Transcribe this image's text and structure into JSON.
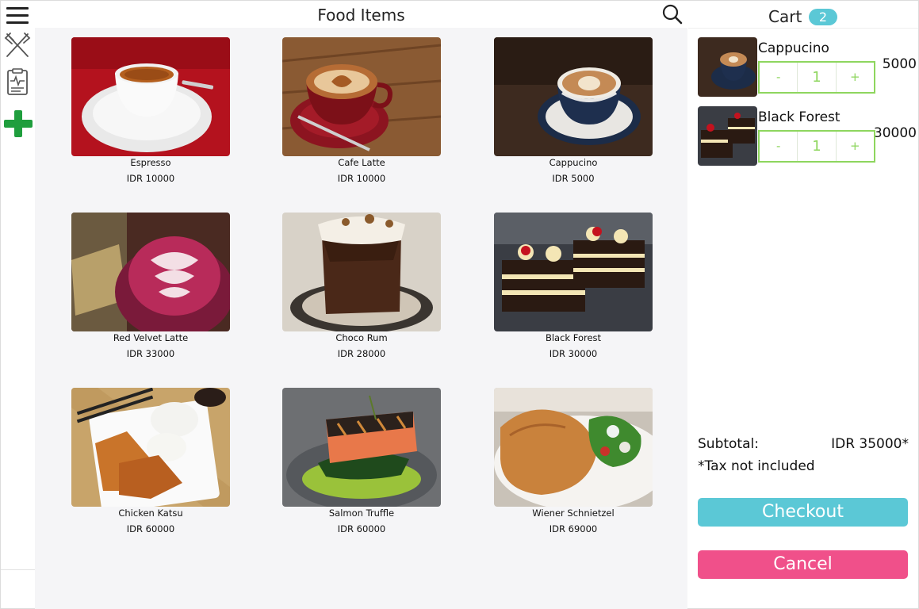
{
  "header": {
    "title": "Food Items"
  },
  "sidebar": {
    "icons": [
      "menu-icon",
      "utensils-icon",
      "report-icon",
      "add-icon"
    ],
    "add_color": "#1f9e3d"
  },
  "menu": {
    "items": [
      {
        "name": "Espresso",
        "price": "IDR 10000"
      },
      {
        "name": "Cafe Latte",
        "price": "IDR 10000"
      },
      {
        "name": "Cappucino",
        "price": "IDR 5000"
      },
      {
        "name": "Red Velvet Latte",
        "price": "IDR 33000"
      },
      {
        "name": "Choco Rum",
        "price": "IDR 28000"
      },
      {
        "name": "Black Forest",
        "price": "IDR 30000"
      },
      {
        "name": "Chicken Katsu",
        "price": "IDR 60000"
      },
      {
        "name": "Salmon Truffle",
        "price": "IDR 60000"
      },
      {
        "name": "Wiener Schnietzel",
        "price": "IDR 69000"
      }
    ]
  },
  "cart": {
    "title": "Cart",
    "count": "2",
    "items": [
      {
        "name": "Cappucino",
        "price": "5000",
        "minus": "-",
        "qty": "1",
        "plus": "+"
      },
      {
        "name": "Black Forest",
        "price": "30000",
        "minus": "-",
        "qty": "1",
        "plus": "+"
      }
    ],
    "subtotal_label": "Subtotal:",
    "subtotal_value": "IDR 35000*",
    "tax_note": "*Tax not included",
    "checkout_label": "Checkout",
    "cancel_label": "Cancel"
  },
  "colors": {
    "badge": "#5bc8d6",
    "checkout": "#5bc8d6",
    "cancel": "#f0508a",
    "stepper": "#8ed65e"
  }
}
